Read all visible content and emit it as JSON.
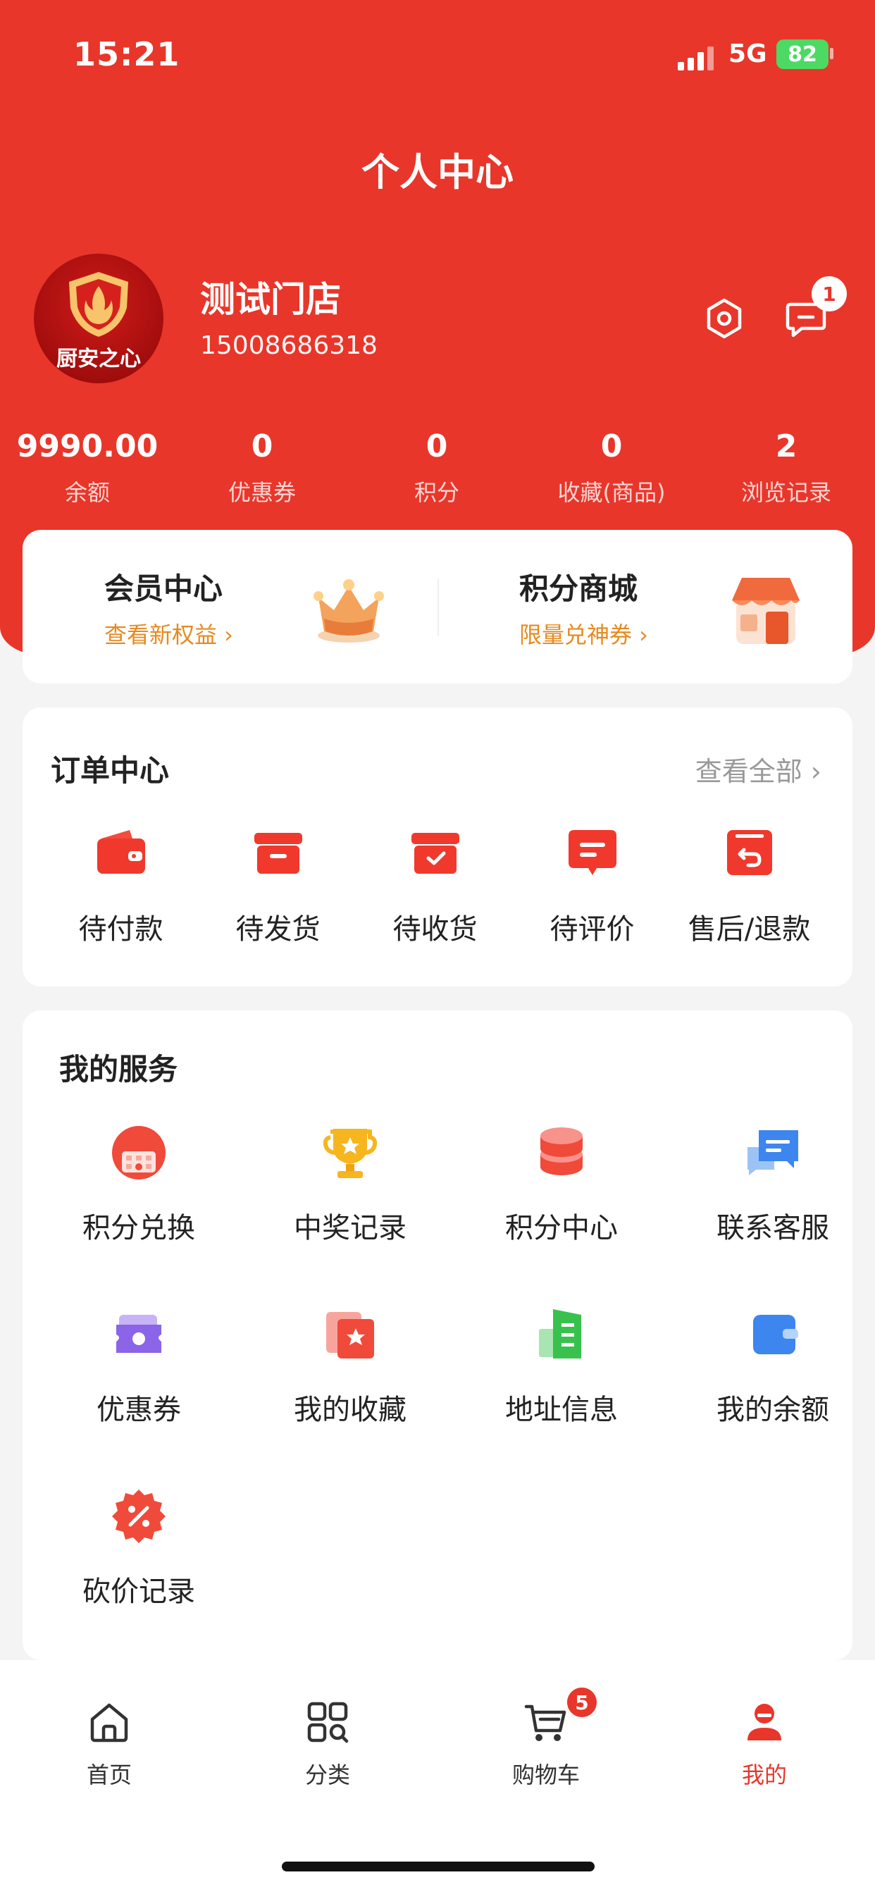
{
  "status_bar": {
    "time": "15:21",
    "network": "5G",
    "battery": "82"
  },
  "header": {
    "title": "个人中心"
  },
  "profile": {
    "avatar_text": "厨安之心",
    "name": "测试门店",
    "phone": "15008686318",
    "message_badge": "1"
  },
  "stats": [
    {
      "value": "9990.00",
      "label": "余额"
    },
    {
      "value": "0",
      "label": "优惠券"
    },
    {
      "value": "0",
      "label": "积分"
    },
    {
      "value": "0",
      "label": "收藏(商品)"
    },
    {
      "value": "2",
      "label": "浏览记录"
    }
  ],
  "promo": [
    {
      "title": "会员中心",
      "subtitle": "查看新权益 ›"
    },
    {
      "title": "积分商城",
      "subtitle": "限量兑神券 ›"
    }
  ],
  "orders": {
    "title": "订单中心",
    "view_all": "查看全部 ›",
    "items": [
      {
        "label": "待付款",
        "icon": "wallet-icon"
      },
      {
        "label": "待发货",
        "icon": "box-icon"
      },
      {
        "label": "待收货",
        "icon": "box-check-icon"
      },
      {
        "label": "待评价",
        "icon": "comment-icon"
      },
      {
        "label": "售后/退款",
        "icon": "refund-icon"
      }
    ]
  },
  "services": {
    "title": "我的服务",
    "items": [
      {
        "label": "积分兑换",
        "icon": "exchange-icon"
      },
      {
        "label": "中奖记录",
        "icon": "trophy-icon"
      },
      {
        "label": "积分中心",
        "icon": "coins-icon"
      },
      {
        "label": "联系客服",
        "icon": "chat-icon"
      },
      {
        "label": "优惠券",
        "icon": "coupon-icon"
      },
      {
        "label": "我的收藏",
        "icon": "favorite-icon"
      },
      {
        "label": "地址信息",
        "icon": "building-icon"
      },
      {
        "label": "我的余额",
        "icon": "wallet-icon"
      },
      {
        "label": "砍价记录",
        "icon": "discount-icon"
      }
    ]
  },
  "tabs": [
    {
      "label": "首页",
      "icon": "home-icon"
    },
    {
      "label": "分类",
      "icon": "category-icon"
    },
    {
      "label": "购物车",
      "icon": "cart-icon",
      "badge": "5"
    },
    {
      "label": "我的",
      "icon": "user-icon",
      "active": true
    }
  ],
  "colors": {
    "primary": "#e8362a",
    "accent": "#e68a1f"
  }
}
